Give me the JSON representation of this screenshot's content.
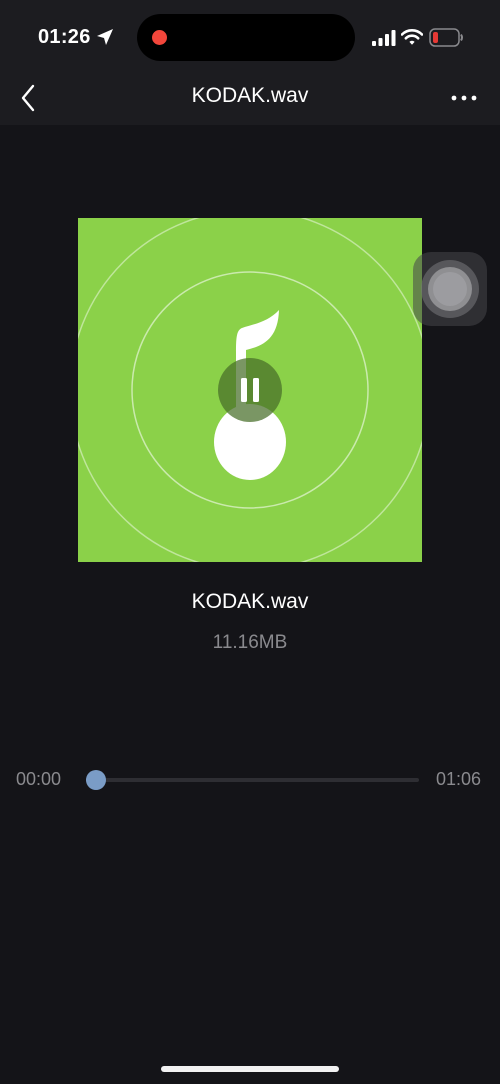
{
  "status_bar": {
    "time": "01:26",
    "recording_color": "#f2463b",
    "battery_color": "#e53935",
    "icons": [
      "location-arrow-icon",
      "signal-icon",
      "wifi-icon",
      "battery-icon"
    ]
  },
  "nav": {
    "title": "KODAK.wav",
    "back_icon": "chevron-left-icon",
    "more_icon": "more-icon"
  },
  "player": {
    "artwork_color": "#8bd149",
    "artwork_icon": "music-note-icon",
    "control_icon": "pause-icon",
    "track_name": "KODAK.wav",
    "file_size": "11.16MB",
    "elapsed": "00:00",
    "duration": "01:06",
    "progress": 0.03,
    "accent_color": "#7a9cc6"
  }
}
